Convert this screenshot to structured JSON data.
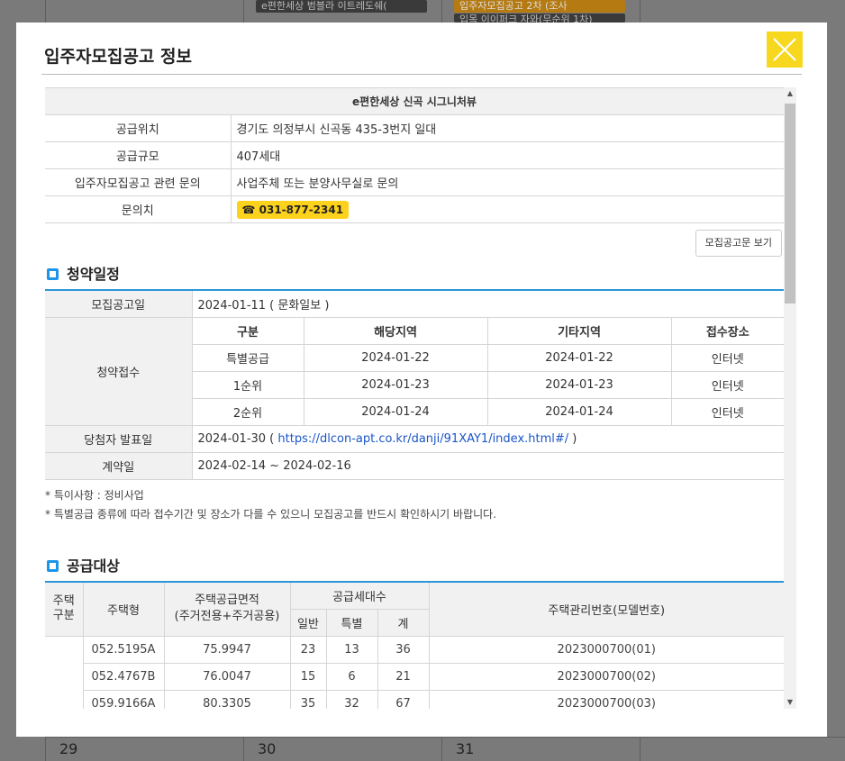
{
  "background": {
    "days": [
      "29",
      "30",
      "31"
    ],
    "chips": [
      "e편한세상 범블라 이트레도쉐(",
      "입주자모집공고 2차 (조사",
      "입목 이이퍼크 자와(무순위 1차)"
    ]
  },
  "modal": {
    "title": "입주자모집공고 정보",
    "close_label": "close",
    "complex_name": "e편한세상 신곡 시그니처뷰",
    "info_rows": [
      {
        "label": "공급위치",
        "value": "경기도 의정부시 신곡동 435-3번지 일대"
      },
      {
        "label": "공급규모",
        "value": "407세대"
      },
      {
        "label": "입주자모집공고 관련 문의",
        "value": "사업주체 또는 분양사무실로 문의"
      }
    ],
    "contact_label": "문의치",
    "phone": "☎ 031-877-2341",
    "doc_button": "모집공고문 보기",
    "schedule": {
      "section_title": "청약일정",
      "announce_label": "모집공고일",
      "announce_value": "2024-01-11 ( 문화일보 )",
      "apply_label": "청약접수",
      "columns": [
        "구분",
        "해당지역",
        "기타지역",
        "접수장소"
      ],
      "rows": [
        [
          "특별공급",
          "2024-01-22",
          "2024-01-22",
          "인터넷"
        ],
        [
          "1순위",
          "2024-01-23",
          "2024-01-23",
          "인터넷"
        ],
        [
          "2순위",
          "2024-01-24",
          "2024-01-24",
          "인터넷"
        ]
      ],
      "winner_label": "당첨자 발표일",
      "winner_prefix": "2024-01-30 ( ",
      "winner_link": "https://dlcon-apt.co.kr/danji/91XAY1/index.html#/",
      "winner_suffix": " )",
      "contract_label": "계약일",
      "contract_value": "2024-02-14 ~ 2024-02-16"
    },
    "notes": [
      "* 특이사항 : 정비사업",
      "* 특별공급 종류에 따라 접수기간 및 장소가 다를 수 있으니 모집공고를 반드시 확인하시기 바랍니다."
    ],
    "supply": {
      "section_title": "공급대상",
      "headers": {
        "type_group": "주택\n구분",
        "model": "주택형",
        "area": "주택공급면적\n(주거전용+주거공용)",
        "households": "공급세대수",
        "general": "일반",
        "special": "특별",
        "total": "계",
        "mgmt_no": "주택관리번호(모델번호)"
      },
      "rows": [
        [
          "052.5195A",
          "75.9947",
          "23",
          "13",
          "36",
          "2023000700(01)"
        ],
        [
          "052.4767B",
          "76.0047",
          "15",
          "6",
          "21",
          "2023000700(02)"
        ],
        [
          "059.9166A",
          "80.3305",
          "35",
          "32",
          "67",
          "2023000700(03)"
        ]
      ]
    }
  },
  "colors": {
    "accent": "#2b95d9",
    "close": "#f7d81e",
    "phone": "#fcd21c"
  }
}
